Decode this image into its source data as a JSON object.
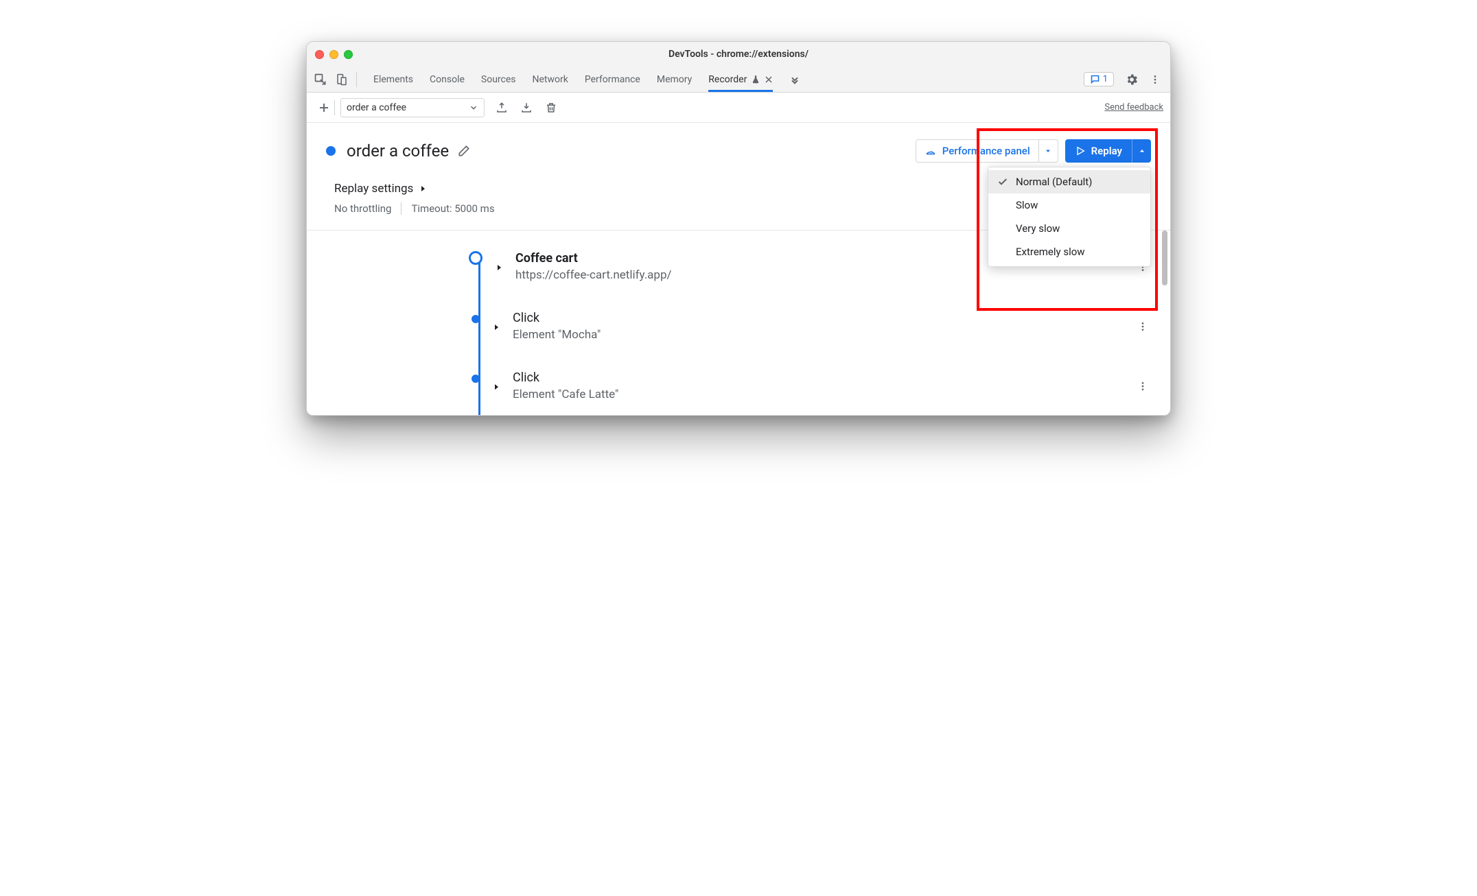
{
  "window": {
    "title": "DevTools - chrome://extensions/"
  },
  "tabs": {
    "items": [
      "Elements",
      "Console",
      "Sources",
      "Network",
      "Performance",
      "Memory",
      "Recorder"
    ],
    "active_index": 6,
    "issues_badge": "1"
  },
  "toolbar": {
    "recording_name": "order a coffee",
    "feedback": "Send feedback"
  },
  "header": {
    "title": "order a coffee",
    "perf_panel_label": "Performance panel",
    "replay_label": "Replay"
  },
  "speed_menu": {
    "items": [
      "Normal (Default)",
      "Slow",
      "Very slow",
      "Extremely slow"
    ],
    "selected_index": 0
  },
  "settings": {
    "label": "Replay settings",
    "throttling": "No throttling",
    "timeout": "Timeout: 5000 ms"
  },
  "steps": [
    {
      "title": "Coffee cart",
      "sub": "https://coffee-cart.netlify.app/",
      "bold": true,
      "hollow": true
    },
    {
      "title": "Click",
      "sub": "Element \"Mocha\"",
      "bold": false,
      "hollow": false
    },
    {
      "title": "Click",
      "sub": "Element \"Cafe Latte\"",
      "bold": false,
      "hollow": false
    }
  ]
}
